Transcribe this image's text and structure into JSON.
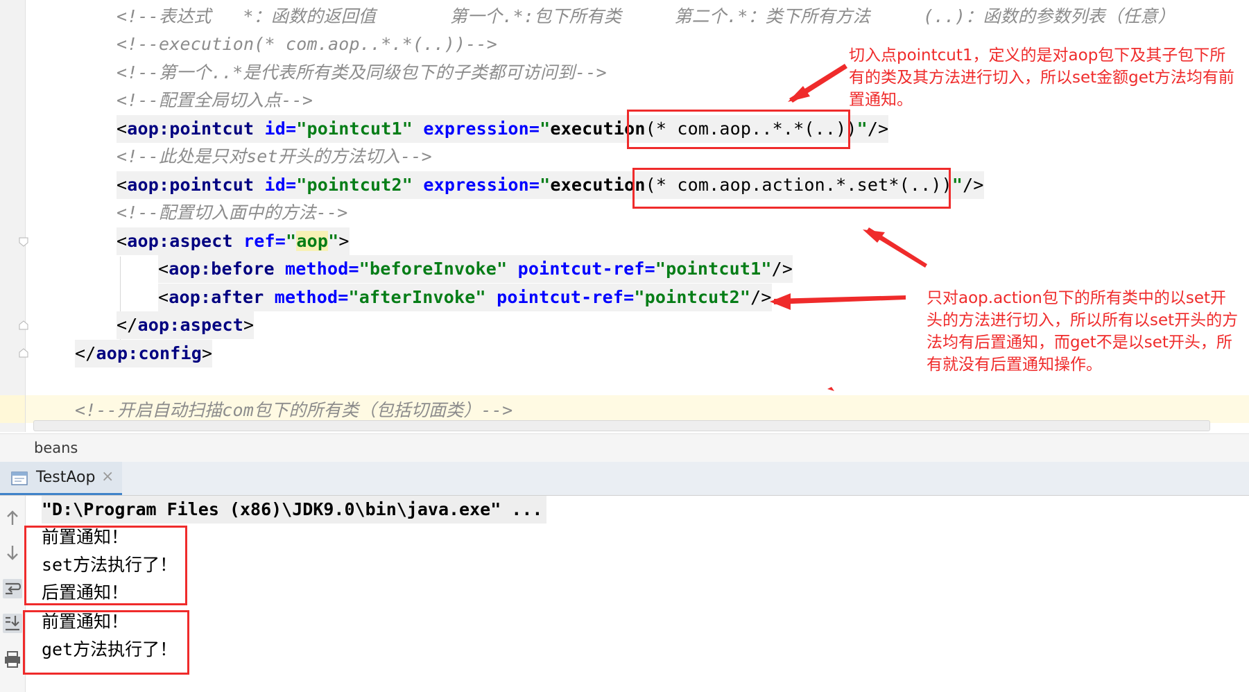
{
  "editor": {
    "lines": [
      {
        "kind": "comment",
        "text": "<!--表达式   *：函数的返回值       第一个.*:包下所有类     第二个.*：类下所有方法     (..)：函数的参数列表（任意）"
      },
      {
        "kind": "comment",
        "text": "<!--execution(* com.aop..*.*(..))-->"
      },
      {
        "kind": "comment",
        "text": "<!--第一个..*是代表所有类及同级包下的子类都可访问到-->"
      },
      {
        "kind": "comment",
        "text": "<!--配置全局切入点-->"
      },
      {
        "kind": "pointcut1",
        "lt": "<",
        "tag": "aop:pointcut",
        "a1": " id=",
        "v1": "\"pointcut1\"",
        "a2": " expression=",
        "v2a": "\"",
        "v2b": "execution",
        "v2c": "(* com.aop..*.*(..))",
        "v2d": "\"",
        "end": "/>"
      },
      {
        "kind": "comment",
        "text": "<!--此处是只对set开头的方法切入-->"
      },
      {
        "kind": "pointcut2",
        "lt": "<",
        "tag": "aop:pointcut",
        "a1": " id=",
        "v1": "\"pointcut2\"",
        "a2": " expression=",
        "v2a": "\"",
        "v2b": "execution",
        "v2c": "(* com.aop.action.*.set*(..))",
        "v2d": "\"",
        "end": "/>"
      },
      {
        "kind": "comment",
        "text": "<!--配置切入面中的方法-->"
      },
      {
        "kind": "aspect",
        "lt": "<",
        "tag": "aop:aspect",
        "a1": " ref=",
        "q1": "\"",
        "v1": "aop",
        "q2": "\"",
        "end": ">"
      },
      {
        "kind": "before",
        "lt": "<",
        "tag": "aop:before",
        "a1": " method=",
        "v1": "\"beforeInvoke\"",
        "a2": " pointcut-ref=",
        "v2": "\"pointcut1\"",
        "end": "/>"
      },
      {
        "kind": "after",
        "lt": "<",
        "tag": "aop:after",
        "a1": " method=",
        "v1": "\"afterInvoke\"",
        "a2": " pointcut-ref=",
        "v2": "\"pointcut2\"",
        "end": "/>"
      },
      {
        "kind": "close",
        "lt": "</",
        "tag": "aop:aspect",
        "end": ">"
      },
      {
        "kind": "close2",
        "lt": "</",
        "tag": "aop:config",
        "end": ">"
      },
      {
        "kind": "comment",
        "text": "<!--开启自动扫描com包下的所有类（包括切面类）-->"
      }
    ]
  },
  "annotations": {
    "note1": "切入点pointcut1，定义的是对aop包下及其子包下所有的类及其方法进行切入，所以set金额get方法均有前置通知。",
    "note2": "只对aop.action包下的所有类中的以set开头的方法进行切入，所以所有以set开头的方法均有后置通知，而get不是以set开头，所有就没有后置通知操作。",
    "color": "#ef2b2b"
  },
  "breadcrumb": {
    "item": "beans"
  },
  "run_panel": {
    "tab_label": "TestAop",
    "close_glyph": "×",
    "command": "\"D:\\Program Files (x86)\\JDK9.0\\bin\\java.exe\" ...",
    "output": [
      "前置通知！",
      "set方法执行了！",
      "后置通知！",
      "前置通知！",
      "get方法执行了！"
    ]
  },
  "icons": [
    "fold-marker-icon",
    "run-config-icon",
    "close-icon",
    "up-arrow-icon",
    "down-arrow-icon",
    "soft-wrap-icon",
    "scroll-to-end-icon",
    "print-icon"
  ]
}
